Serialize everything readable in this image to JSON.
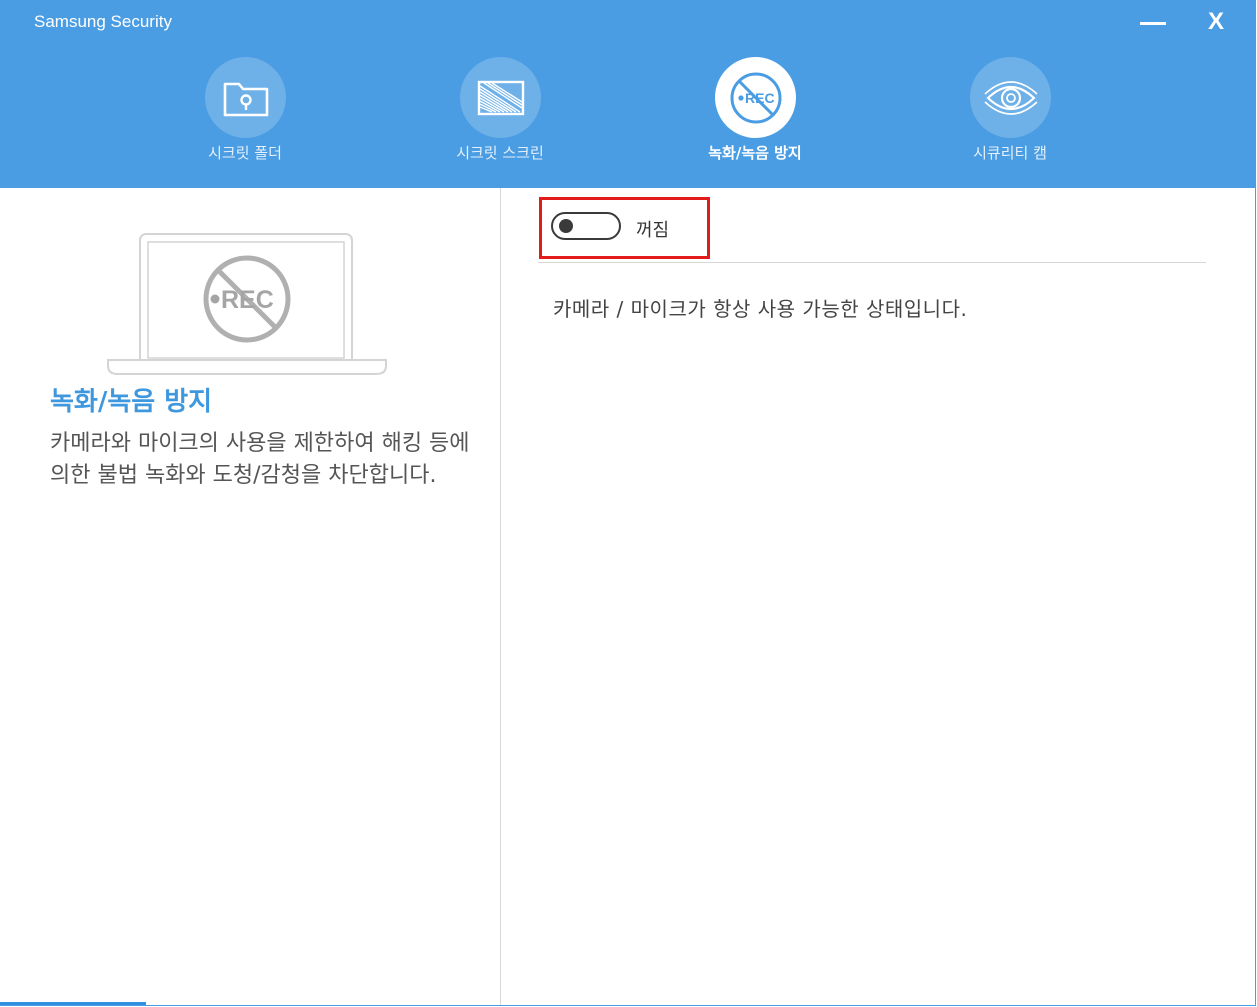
{
  "window": {
    "title": "Samsung Security",
    "minimize_label": "",
    "close_label": "X"
  },
  "tabs": [
    {
      "label": "시크릿 폴더",
      "icon": "folder-key-icon",
      "active": false
    },
    {
      "label": "시크릿 스크린",
      "icon": "privacy-screen-icon",
      "active": false
    },
    {
      "label": "녹화/녹음 방지",
      "icon": "no-rec-icon",
      "active": true
    },
    {
      "label": "시큐리티 캠",
      "icon": "security-cam-eye-icon",
      "active": false
    }
  ],
  "feature": {
    "title": "녹화/녹음 방지",
    "description": "카메라와 마이크의 사용을 제한하여 해킹 등에 의한 불법 녹화와 도청/감청을 차단합니다.",
    "illustration": "laptop-no-rec-icon"
  },
  "toggle": {
    "state": "off",
    "label": "꺼짐"
  },
  "status_message": "카메라 / 마이크가 항상 사용 가능한 상태입니다.",
  "colors": {
    "header": "#4a9de3",
    "accent_title": "#3f98dd",
    "highlight_border": "#e31b1b"
  }
}
